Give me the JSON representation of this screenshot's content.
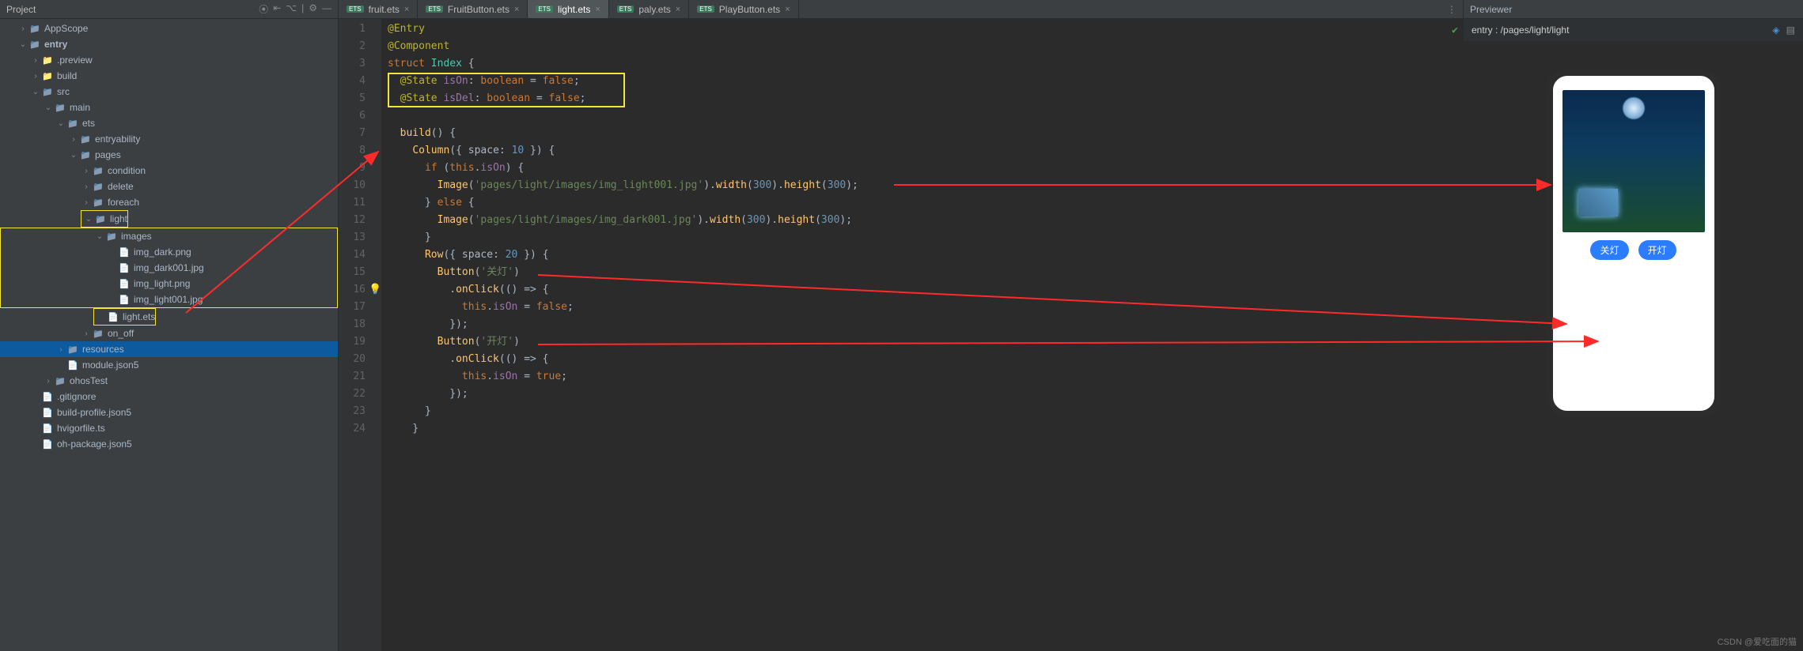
{
  "sidebar": {
    "title": "Project",
    "icons": [
      "target-icon",
      "collapse-icon",
      "show-options-icon",
      "gear-icon",
      "hide-icon"
    ],
    "tree": [
      {
        "label": "AppScope",
        "depth": 1,
        "icon": "folder",
        "arrow": ">"
      },
      {
        "label": "entry",
        "depth": 1,
        "icon": "folder",
        "arrow": "v",
        "bold": true
      },
      {
        "label": ".preview",
        "depth": 2,
        "icon": "folder-orange",
        "arrow": ">"
      },
      {
        "label": "build",
        "depth": 2,
        "icon": "folder-orange",
        "arrow": ">"
      },
      {
        "label": "src",
        "depth": 2,
        "icon": "folder",
        "arrow": "v"
      },
      {
        "label": "main",
        "depth": 3,
        "icon": "folder",
        "arrow": "v"
      },
      {
        "label": "ets",
        "depth": 4,
        "icon": "folder",
        "arrow": "v"
      },
      {
        "label": "entryability",
        "depth": 5,
        "icon": "folder",
        "arrow": ">"
      },
      {
        "label": "pages",
        "depth": 5,
        "icon": "folder",
        "arrow": "v"
      },
      {
        "label": "condition",
        "depth": 6,
        "icon": "folder",
        "arrow": ">"
      },
      {
        "label": "delete",
        "depth": 6,
        "icon": "folder",
        "arrow": ">"
      },
      {
        "label": "foreach",
        "depth": 6,
        "icon": "folder",
        "arrow": ">"
      },
      {
        "label": "light",
        "depth": 6,
        "icon": "folder",
        "arrow": "v",
        "hl": true
      },
      {
        "label": "images",
        "depth": 7,
        "icon": "folder",
        "arrow": "v",
        "hlgroup": "start"
      },
      {
        "label": "img_dark.png",
        "depth": 8,
        "icon": "file",
        "arrow": ""
      },
      {
        "label": "img_dark001.jpg",
        "depth": 8,
        "icon": "file",
        "arrow": ""
      },
      {
        "label": "img_light.png",
        "depth": 8,
        "icon": "file",
        "arrow": ""
      },
      {
        "label": "img_light001.jpg",
        "depth": 8,
        "icon": "file",
        "arrow": "",
        "hlgroup": "end"
      },
      {
        "label": "light.ets",
        "depth": 7,
        "icon": "file",
        "arrow": "",
        "hl": true
      },
      {
        "label": "on_off",
        "depth": 6,
        "icon": "folder",
        "arrow": ">"
      },
      {
        "label": "resources",
        "depth": 4,
        "icon": "folder",
        "arrow": ">",
        "selected": true
      },
      {
        "label": "module.json5",
        "depth": 4,
        "icon": "file",
        "arrow": ""
      },
      {
        "label": "ohosTest",
        "depth": 3,
        "icon": "folder",
        "arrow": ">"
      },
      {
        "label": ".gitignore",
        "depth": 2,
        "icon": "file",
        "arrow": ""
      },
      {
        "label": "build-profile.json5",
        "depth": 2,
        "icon": "file",
        "arrow": ""
      },
      {
        "label": "hvigorfile.ts",
        "depth": 2,
        "icon": "file",
        "arrow": ""
      },
      {
        "label": "oh-package.json5",
        "depth": 2,
        "icon": "file",
        "arrow": ""
      }
    ]
  },
  "tabs": [
    {
      "label": "fruit.ets",
      "active": false
    },
    {
      "label": "FruitButton.ets",
      "active": false
    },
    {
      "label": "light.ets",
      "active": true
    },
    {
      "label": "paly.ets",
      "active": false
    },
    {
      "label": "PlayButton.ets",
      "active": false
    }
  ],
  "code_lines": [
    {
      "n": 1,
      "html": "<span class='ann'>@Entry</span>"
    },
    {
      "n": 2,
      "html": "<span class='ann'>@Component</span>"
    },
    {
      "n": 3,
      "html": "<span class='kw'>struct</span> <span class='type'>Index</span> {"
    },
    {
      "n": 4,
      "html": "  <span class='ann'>@State</span> <span class='id'>isOn</span>: <span class='kw'>boolean</span> = <span class='kw'>false</span>;",
      "hlrow": true
    },
    {
      "n": 5,
      "html": "  <span class='ann'>@State</span> <span class='id'>isDel</span>: <span class='kw'>boolean</span> = <span class='kw'>false</span>;",
      "hlrow": true
    },
    {
      "n": 6,
      "html": ""
    },
    {
      "n": 7,
      "html": "  <span class='fn'>build</span>() {"
    },
    {
      "n": 8,
      "html": "    <span class='fn'>Column</span>({ space: <span class='num'>10</span> }) {"
    },
    {
      "n": 9,
      "html": "      <span class='kw'>if</span> (<span class='kw'>this</span>.<span class='id'>isOn</span>) {"
    },
    {
      "n": 10,
      "html": "        <span class='fn'>Image</span>(<span class='str'>'pages/light/images/img_light001.jpg'</span>).<span class='fn'>width</span>(<span class='num'>300</span>).<span class='fn'>height</span>(<span class='num'>300</span>);"
    },
    {
      "n": 11,
      "html": "      } <span class='kw'>else</span> {"
    },
    {
      "n": 12,
      "html": "        <span class='fn'>Image</span>(<span class='str'>'pages/light/images/img_dark001.jpg'</span>).<span class='fn'>width</span>(<span class='num'>300</span>).<span class='fn'>height</span>(<span class='num'>300</span>);"
    },
    {
      "n": 13,
      "html": "      }"
    },
    {
      "n": 14,
      "html": "      <span class='fn'>Row</span>({ space: <span class='num'>20</span> }) {"
    },
    {
      "n": 15,
      "html": "        <span class='fn'>Button</span>(<span class='str'>'关灯'</span>)"
    },
    {
      "n": 16,
      "html": "          .<span class='fn'>onClick</span>(() =&gt; <span class='op'>{</span>",
      "bulb": true
    },
    {
      "n": 17,
      "html": "            <span class='kw'>this</span>.<span class='id'>isOn</span> = <span class='kw'>false</span>;"
    },
    {
      "n": 18,
      "html": "          <span class='op'>}</span>);"
    },
    {
      "n": 19,
      "html": "        <span class='fn'>Button</span>(<span class='str'>'开灯'</span>)"
    },
    {
      "n": 20,
      "html": "          .<span class='fn'>onClick</span>(() =&gt; {"
    },
    {
      "n": 21,
      "html": "            <span class='kw'>this</span>.<span class='id'>isOn</span> = <span class='kw'>true</span>;"
    },
    {
      "n": 22,
      "html": "          });"
    },
    {
      "n": 23,
      "html": "      }"
    },
    {
      "n": 24,
      "html": "    }"
    }
  ],
  "preview": {
    "title": "Previewer",
    "path": "entry : /pages/light/light",
    "btn_off": "关灯",
    "btn_on": "开灯"
  },
  "watermark": "CSDN @爱吃面的猫"
}
